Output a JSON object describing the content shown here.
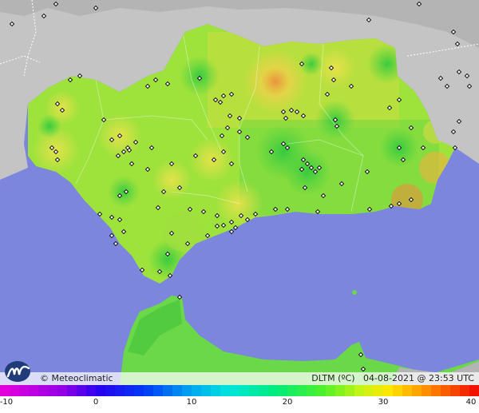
{
  "map": {
    "credit": "© Meteoclimatic",
    "variable": "DLTM (ºC)",
    "date": "04-08-2021",
    "at": "@",
    "time": "23:53 UTC",
    "logo_icon": "meteoclimatic-logo-icon",
    "colors": {
      "sea": "#7b86dc",
      "land_outside": "#c4c4c4",
      "land_base": "#9ee23c",
      "credit_bg": "#ffffff"
    },
    "scale": {
      "min": -10,
      "max": 40,
      "ticks": [
        "-10",
        "0",
        "10",
        "20",
        "30",
        "40"
      ],
      "tick_values": [
        -10,
        0,
        10,
        20,
        30,
        40
      ]
    }
  }
}
